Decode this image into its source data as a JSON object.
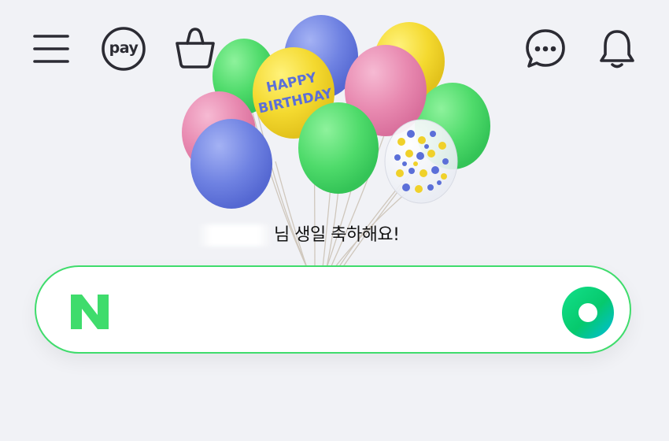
{
  "header": {
    "menu_icon": "hamburger-menu-icon",
    "pay_label": "pay",
    "shopping_icon": "shopping-bag-icon",
    "talk_icon": "chat-bubble-icon",
    "notification_icon": "bell-icon"
  },
  "celebration": {
    "balloon_label_line1": "HAPPY",
    "balloon_label_line2": "BIRTHDAY",
    "message_suffix": "님 생일 축하해요!"
  },
  "search": {
    "logo_letter": "N",
    "query_value": "",
    "voice_icon": "green-circle-voice-icon"
  },
  "colors": {
    "brand_green": "#03c75a",
    "search_border": "#3fdc6c",
    "background": "#f1f2f6"
  }
}
